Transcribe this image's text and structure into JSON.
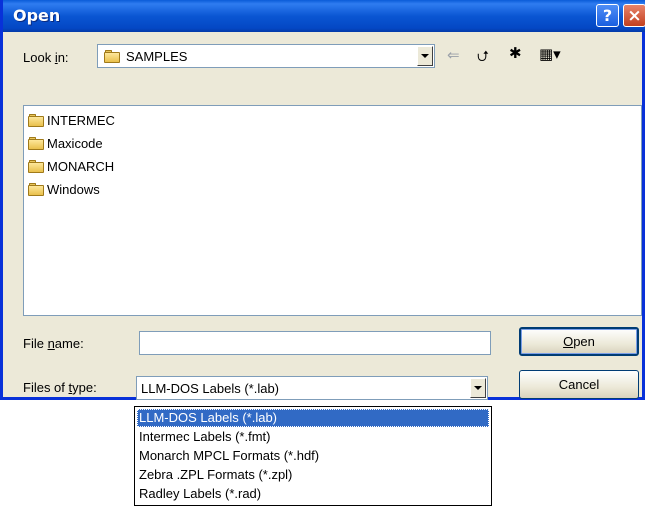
{
  "window": {
    "title": "Open",
    "help_glyph": "?",
    "close_glyph": "×"
  },
  "look_in": {
    "label_prefix": "Look ",
    "label_mnemonic": "i",
    "label_suffix": "n:",
    "value": "SAMPLES",
    "icon": "folder-icon"
  },
  "toolbar": {
    "back_icon": "back-arrow-icon",
    "up_icon": "up-folder-icon",
    "new_folder_icon": "new-folder-icon",
    "views_icon": "views-menu-icon"
  },
  "file_list": {
    "items": [
      {
        "name": "INTERMEC",
        "icon": "folder-icon"
      },
      {
        "name": "Maxicode",
        "icon": "folder-icon"
      },
      {
        "name": "MONARCH",
        "icon": "folder-icon"
      },
      {
        "name": "Windows",
        "icon": "folder-icon"
      }
    ]
  },
  "file_name": {
    "label_prefix": "File ",
    "label_mnemonic": "n",
    "label_suffix": "ame:",
    "value": ""
  },
  "files_of_type": {
    "label_prefix": "Files of ",
    "label_mnemonic": "t",
    "label_suffix": "ype:",
    "value": "LLM-DOS Labels (*.lab)",
    "options": [
      "LLM-DOS Labels (*.lab)",
      "Intermec Labels (*.fmt)",
      "Monarch MPCL Formats (*.hdf)",
      "Zebra .ZPL Formats (*.zpl)",
      "Radley Labels (*.rad)"
    ],
    "selected_index": 0
  },
  "buttons": {
    "open_mnemonic": "O",
    "open_rest": "pen",
    "cancel": "Cancel"
  },
  "colors": {
    "titlebar": "#0a56d3",
    "dialog_bg": "#ece9d8",
    "selection": "#316ac5"
  }
}
